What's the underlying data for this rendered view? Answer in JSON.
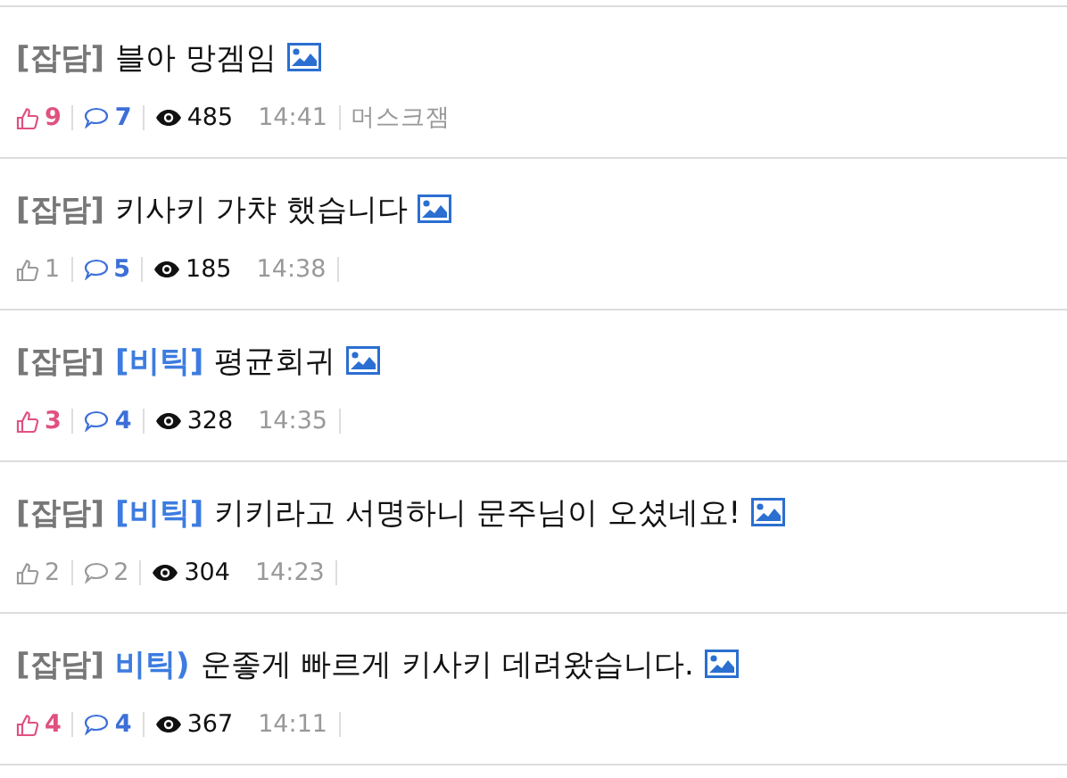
{
  "posts": [
    {
      "category": "[잡담]",
      "title": "블아 망겜임",
      "has_image": true,
      "likes": "9",
      "likes_highlighted": true,
      "comments": "7",
      "comments_highlighted": true,
      "views": "485",
      "time": "14:41",
      "author": "머스크잼"
    },
    {
      "category": "[잡담]",
      "title": "키사키 가챠 했습니다",
      "has_image": true,
      "likes": "1",
      "likes_highlighted": false,
      "comments": "5",
      "comments_highlighted": true,
      "views": "185",
      "time": "14:38"
    },
    {
      "category": "[잡담]",
      "tag": "[비틱]",
      "title": "평균회귀",
      "has_image": true,
      "likes": "3",
      "likes_highlighted": true,
      "comments": "4",
      "comments_highlighted": true,
      "views": "328",
      "time": "14:35"
    },
    {
      "category": "[잡담]",
      "tag": "[비틱]",
      "title": "키키라고 서명하니 문주님이 오셨네요!",
      "has_image": true,
      "likes": "2",
      "likes_highlighted": false,
      "comments": "2",
      "comments_highlighted": false,
      "views": "304",
      "time": "14:23"
    },
    {
      "category": "[잡담]",
      "tag": "비틱)",
      "title": "운좋게 빠르게 키사키 데려왔습니다.",
      "has_image": true,
      "likes": "4",
      "likes_highlighted": true,
      "comments": "4",
      "comments_highlighted": true,
      "views": "367",
      "time": "14:11"
    }
  ]
}
